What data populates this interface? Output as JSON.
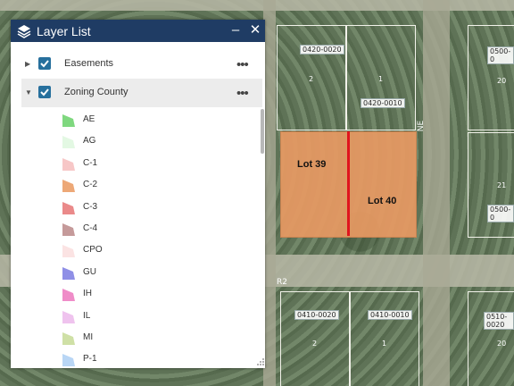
{
  "panel": {
    "title": "Layer List",
    "minimize_label": "–",
    "close_label": "✕"
  },
  "layers": [
    {
      "label": "Easements",
      "checked": true,
      "expanded": false,
      "more": "•••"
    },
    {
      "label": "Zoning County",
      "checked": true,
      "expanded": true,
      "more": "•••"
    }
  ],
  "legend": [
    {
      "label": "AE",
      "color": "#7fd87f"
    },
    {
      "label": "AG",
      "color": "#e3f8e3"
    },
    {
      "label": "C-1",
      "color": "#f7c7c7"
    },
    {
      "label": "C-2",
      "color": "#eda877"
    },
    {
      "label": "C-3",
      "color": "#ea8a8a"
    },
    {
      "label": "C-4",
      "color": "#c59a9a"
    },
    {
      "label": "CPO",
      "color": "#fbe3e3"
    },
    {
      "label": "GU",
      "color": "#8f8fe6"
    },
    {
      "label": "IH",
      "color": "#ef8cc8"
    },
    {
      "label": "IL",
      "color": "#efc3ee"
    },
    {
      "label": "MI",
      "color": "#cfe0a6"
    },
    {
      "label": "P-1",
      "color": "#b9d6f5"
    }
  ],
  "map": {
    "lots": [
      {
        "label": "Lot 39"
      },
      {
        "label": "Lot 40"
      }
    ],
    "zoning_highlight_color": "#e89a63",
    "parcels": [
      "0420-0020",
      "0420-0010",
      "0500-0",
      "0500-0",
      "0410-0020",
      "0410-0010",
      "0510-0020"
    ],
    "parcel_numbers": [
      "2",
      "1",
      "2",
      "1",
      "20",
      "21",
      "20"
    ],
    "streets": [
      "R2",
      "NE"
    ]
  }
}
